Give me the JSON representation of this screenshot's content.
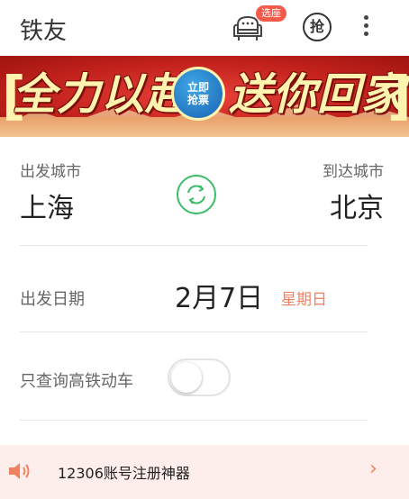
{
  "header": {
    "title": "铁友",
    "seat_badge": "选座",
    "grab_label": "抢",
    "icons": {
      "seat": "sofa-seat-icon",
      "more": "more-vertical-icon"
    }
  },
  "banner": {
    "text_left": "全力以赴",
    "text_right": "送你回家",
    "seal_line1": "立即",
    "seal_line2": "抢票",
    "colors": {
      "background": "#c1211b",
      "text": "#fff3b0"
    }
  },
  "route": {
    "from_label": "出发城市",
    "from_city": "上海",
    "to_label": "到达城市",
    "to_city": "北京"
  },
  "date": {
    "label": "出发日期",
    "value": "2月7日",
    "weekday": "星期日"
  },
  "filter": {
    "hsr_label": "只查询高铁动车",
    "hsr_enabled": false
  },
  "notice": {
    "text": "12306账号注册神器",
    "arrow": "›"
  },
  "colors": {
    "accent_green": "#3cbc68",
    "weekday": "#f08060",
    "badge": "#f35a4a",
    "notice_bg": "#fdeeeb"
  }
}
